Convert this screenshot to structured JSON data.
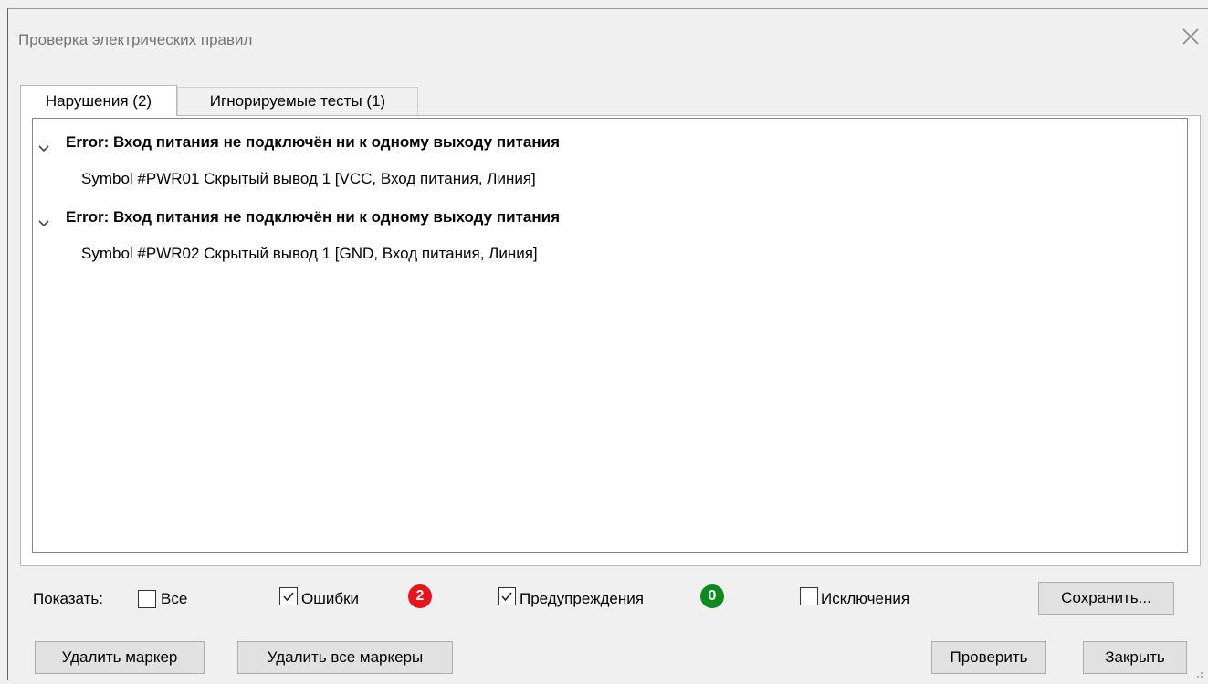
{
  "window": {
    "title": "Проверка электрических правил"
  },
  "tabs": [
    {
      "label": "Нарушения (2)",
      "active": true
    },
    {
      "label": "Игнорируемые тесты (1)",
      "active": false
    }
  ],
  "violations": [
    {
      "header": "Error: Вход питания не подключён ни к одному выходу питания",
      "detail": "Symbol #PWR01 Скрытый вывод 1 [VCC, Вход питания, Линия]",
      "expanded": true
    },
    {
      "header": "Error: Вход питания не подключён ни к одному выходу питания",
      "detail": "Symbol #PWR02 Скрытый вывод 1 [GND, Вход питания, Линия]",
      "expanded": true
    }
  ],
  "filters": {
    "show_label": "Показать:",
    "all": {
      "label": "Все",
      "checked": false
    },
    "errors": {
      "label": "Ошибки",
      "checked": true,
      "count": "2",
      "badge_color": "#e8131b"
    },
    "warnings": {
      "label": "Предупреждения",
      "checked": true,
      "count": "0",
      "badge_color": "#0d8a1d"
    },
    "exclusions": {
      "label": "Исключения",
      "checked": false
    }
  },
  "buttons": {
    "save": "Сохранить...",
    "delete_marker": "Удалить маркер",
    "delete_all_markers": "Удалить все маркеры",
    "run": "Проверить",
    "close": "Закрыть"
  },
  "icons": {
    "close": "close-icon",
    "expand": "chevron-down-icon",
    "check": "checkmark-icon",
    "resize": "resize-grip-icon"
  }
}
